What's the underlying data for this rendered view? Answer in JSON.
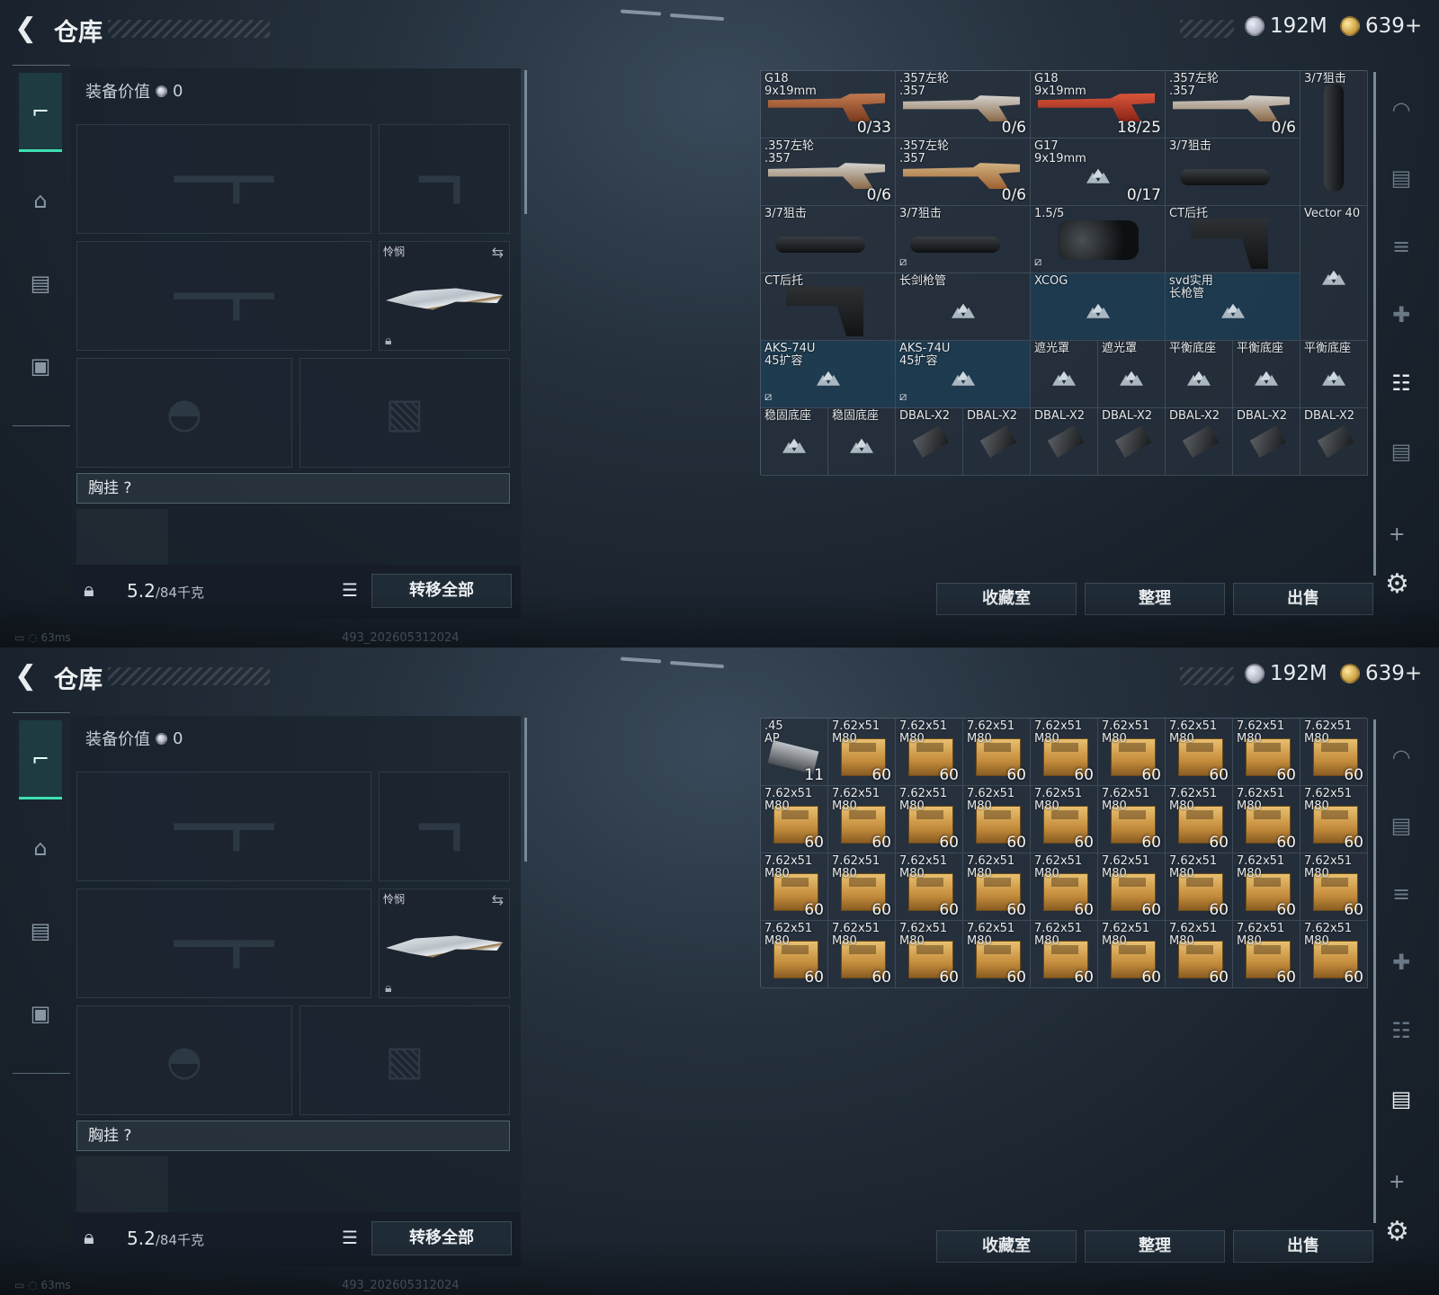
{
  "app_title": "仓库",
  "currency": {
    "silver": "192M",
    "gold": "639+"
  },
  "equip_value_label": "装备价值",
  "equip_value": "0",
  "knife_label": "怜悯",
  "chest_label": "胸挂",
  "chest_help": "?",
  "weight_value": "5.2",
  "weight_max": "/84千克",
  "move_all": "转移全部",
  "buttons": {
    "collection": "收藏室",
    "organize": "整理",
    "sell": "出售"
  },
  "status": {
    "ping": "63ms",
    "build": "493_202605312024"
  },
  "panel1_items": [
    {
      "name": "G18\n9x19mm",
      "count": "0/33",
      "art": "gun copper"
    },
    {
      "name": ".357左轮\n.357",
      "count": "0/6",
      "art": "gun silver"
    },
    {
      "name": "G18\n9x19mm",
      "count": "18/25",
      "art": "gun red"
    },
    {
      "name": ".357左轮\n.357",
      "count": "0/6",
      "art": "gun silver"
    },
    {
      "name": "3/7狙击",
      "count": "",
      "art": "scopev"
    },
    {
      "name": ".357左轮\n.357",
      "count": "0/6",
      "art": "gun silver"
    },
    {
      "name": ".357左轮\n.357",
      "count": "0/6",
      "art": "gun gold"
    },
    {
      "name": "G17\n9x19mm",
      "count": "0/17",
      "art": "tri"
    },
    {
      "name": "3/7狙击",
      "count": "",
      "art": "scope"
    },
    {
      "name": "3/7狙击",
      "count": "",
      "art": "scope"
    },
    {
      "name": "3/7狙击",
      "count": "",
      "art": "scope",
      "nomod": true
    },
    {
      "name": "1.5/5",
      "count": "",
      "art": "thermal",
      "nomod": true
    },
    {
      "name": "CT后托",
      "count": "",
      "art": "stock"
    },
    {
      "name": "Vector 40",
      "count": "",
      "art": "tri"
    },
    {
      "name": "CT后托",
      "count": "",
      "art": "stock"
    },
    {
      "name": "长剑枪管",
      "count": "",
      "art": "tri"
    },
    {
      "name": "XCOG",
      "count": "",
      "art": "tri",
      "bg": "blue"
    },
    {
      "name": "svd实用\n长枪管",
      "count": "",
      "art": "tri",
      "bg": "blue"
    },
    {
      "name": "AKS-74U\n45扩容",
      "count": "",
      "art": "tri",
      "nomod": true,
      "bg": "blue"
    },
    {
      "name": "AKS-74U\n45扩容",
      "count": "",
      "art": "tri",
      "nomod": true,
      "bg": "blue"
    },
    {
      "name": "遮光罩",
      "count": "",
      "art": "tri"
    },
    {
      "name": "遮光罩",
      "count": "",
      "art": "tri"
    },
    {
      "name": "平衡底座",
      "count": "",
      "art": "tri"
    },
    {
      "name": "平衡底座",
      "count": "",
      "art": "tri"
    },
    {
      "name": "平衡底座",
      "count": "",
      "art": "tri"
    },
    {
      "name": "稳固底座",
      "count": "",
      "art": "tri"
    },
    {
      "name": "稳固底座",
      "count": "",
      "art": "tri"
    },
    {
      "name": "DBAL-X2",
      "count": "",
      "art": "dbal"
    },
    {
      "name": "DBAL-X2",
      "count": "",
      "art": "dbal"
    },
    {
      "name": "DBAL-X2",
      "count": "",
      "art": "dbal"
    },
    {
      "name": "DBAL-X2",
      "count": "",
      "art": "dbal"
    },
    {
      "name": "DBAL-X2",
      "count": "",
      "art": "dbal"
    },
    {
      "name": "DBAL-X2",
      "count": "",
      "art": "dbal"
    },
    {
      "name": "DBAL-X2",
      "count": "",
      "art": "dbal"
    }
  ],
  "panel2_first": {
    "name": ".45\nAP",
    "count": "11",
    "art": "mag"
  },
  "panel2_ammo": {
    "name": "7.62x51\nM80",
    "count": "60",
    "art": "ammo"
  }
}
